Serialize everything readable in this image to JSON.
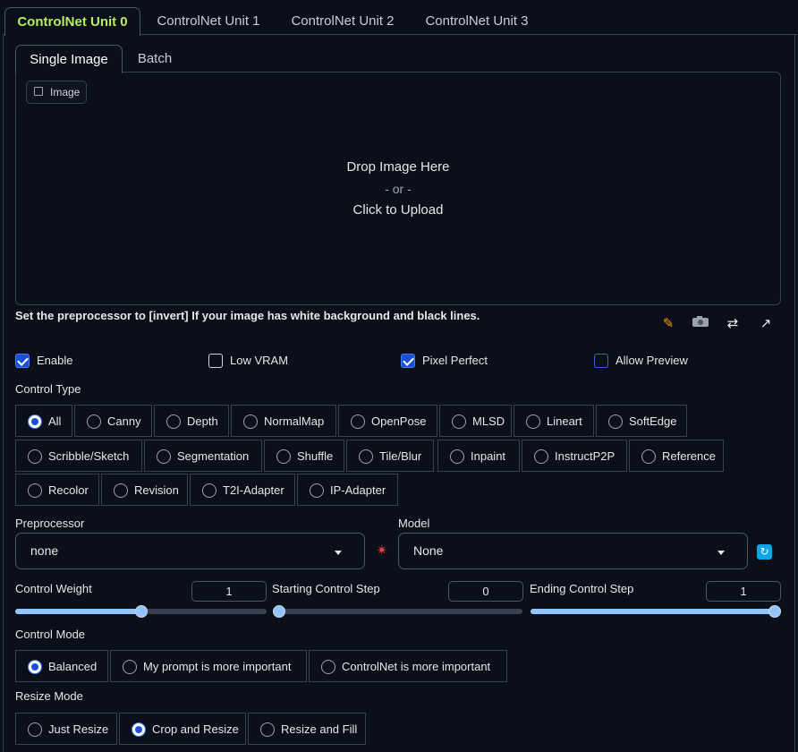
{
  "unit_tabs": [
    "ControlNet Unit 0",
    "ControlNet Unit 1",
    "ControlNet Unit 2",
    "ControlNet Unit 3"
  ],
  "sub_tabs": [
    "Single Image",
    "Batch"
  ],
  "image_label": "Image",
  "drop": {
    "line1": "Drop Image Here",
    "line2": "- or -",
    "line3": "Click to Upload"
  },
  "hint": "Set the preprocessor to [invert] If your image has white background and black lines.",
  "checkboxes": {
    "enable": "Enable",
    "low_vram": "Low VRAM",
    "pixel_perfect": "Pixel Perfect",
    "allow_preview": "Allow Preview"
  },
  "control_type": {
    "label": "Control Type",
    "options": [
      "All",
      "Canny",
      "Depth",
      "NormalMap",
      "OpenPose",
      "MLSD",
      "Lineart",
      "SoftEdge",
      "Scribble/Sketch",
      "Segmentation",
      "Shuffle",
      "Tile/Blur",
      "Inpaint",
      "InstructP2P",
      "Reference",
      "Recolor",
      "Revision",
      "T2I-Adapter",
      "IP-Adapter"
    ],
    "selected": "All"
  },
  "preprocessor": {
    "label": "Preprocessor",
    "value": "none"
  },
  "model": {
    "label": "Model",
    "value": "None"
  },
  "control_weight": {
    "label": "Control Weight",
    "value": "1",
    "fraction": 0.5
  },
  "starting_step": {
    "label": "Starting Control Step",
    "value": "0",
    "fraction": 0
  },
  "ending_step": {
    "label": "Ending Control Step",
    "value": "1",
    "fraction": 1
  },
  "control_mode": {
    "label": "Control Mode",
    "options": [
      "Balanced",
      "My prompt is more important",
      "ControlNet is more important"
    ],
    "selected": "Balanced"
  },
  "resize_mode": {
    "label": "Resize Mode",
    "options": [
      "Just Resize",
      "Crop and Resize",
      "Resize and Fill"
    ],
    "selected": "Crop and Resize"
  },
  "colors": {
    "accent_green": "#b3f05f",
    "accent_blue": "#1d4ed8",
    "slider": "#93c5fd",
    "background": "#0b0f19"
  }
}
